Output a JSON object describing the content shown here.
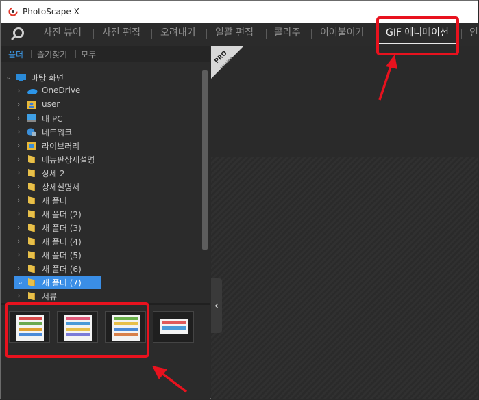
{
  "app": {
    "title": "PhotoScape X"
  },
  "menu": {
    "items": [
      {
        "label": "사진 뷰어"
      },
      {
        "label": "사진 편집"
      },
      {
        "label": "오려내기"
      },
      {
        "label": "일괄 편집"
      },
      {
        "label": "콜라주"
      },
      {
        "label": "이어붙이기"
      },
      {
        "label": "GIF 애니메이션",
        "active": true
      },
      {
        "label": "인"
      }
    ]
  },
  "sidebar": {
    "tabs": [
      {
        "label": "폴더",
        "active": true
      },
      {
        "label": "즐겨찾기"
      },
      {
        "label": "모두"
      }
    ],
    "tree": [
      {
        "label": "바탕 화면",
        "icon": "desktop-icon",
        "expanded": true
      },
      {
        "label": "OneDrive",
        "icon": "cloud-icon"
      },
      {
        "label": "user",
        "icon": "user-folder-icon"
      },
      {
        "label": "내 PC",
        "icon": "pc-icon"
      },
      {
        "label": "네트워크",
        "icon": "network-icon"
      },
      {
        "label": "라이브러리",
        "icon": "library-icon"
      },
      {
        "label": "메뉴판상세설명",
        "icon": "folder-icon"
      },
      {
        "label": "상세 2",
        "icon": "folder-icon"
      },
      {
        "label": "상세설명서",
        "icon": "folder-icon"
      },
      {
        "label": "새 폴더",
        "icon": "folder-icon"
      },
      {
        "label": "새 폴더 (2)",
        "icon": "folder-icon"
      },
      {
        "label": "새 폴더 (3)",
        "icon": "folder-icon"
      },
      {
        "label": "새 폴더 (4)",
        "icon": "folder-icon"
      },
      {
        "label": "새 폴더 (5)",
        "icon": "folder-icon"
      },
      {
        "label": "새 폴더 (6)",
        "icon": "folder-icon"
      },
      {
        "label": "새 폴더 (7)",
        "icon": "folder-icon",
        "selected": true
      },
      {
        "label": "서류",
        "icon": "folder-icon"
      }
    ]
  },
  "main": {
    "badge": {
      "label": "PRO",
      "sublabel": "Version"
    },
    "collapse_icon": "chevron-left-icon"
  },
  "colors": {
    "accent": "#3d9be9",
    "annotation": "#e8121e",
    "selection": "#3a8ee6"
  }
}
